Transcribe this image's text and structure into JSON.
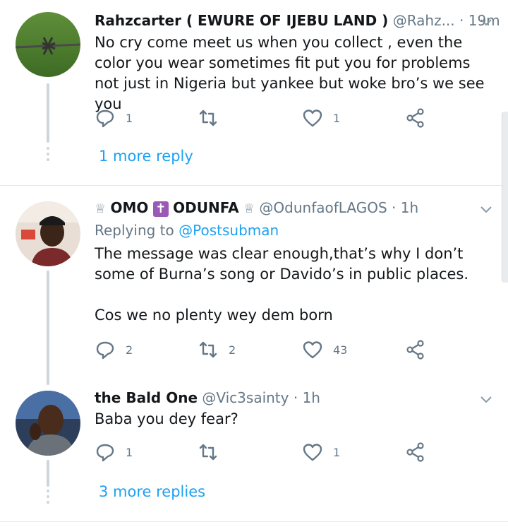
{
  "tweets": [
    {
      "name": "Rahzcarter ( EWURE OF IJEBU LAND )",
      "handle": "@Rahz...",
      "dot": "·",
      "time": "19m",
      "text": "No cry come meet us when you collect , even the color you wear sometimes fit put you for problems not just in Nigeria but yankee but woke bro’s we see you",
      "replies": "1",
      "retweets": "",
      "likes": "1",
      "more": "1 more reply"
    },
    {
      "name_prefix": "♕",
      "name_a": "OMO",
      "name_mid": "✝",
      "name_b": "ODUNFA",
      "name_suffix": "♕",
      "handle": "@OdunfaofLAGOS",
      "dot": "·",
      "time": "1h",
      "replying_label": "Replying to",
      "replying_to": "@Postsubman",
      "text": "The message was clear enough,that’s why I don’t some of Burna’s song or Davido’s in public places.\n\nCos we no plenty wey dem born",
      "replies": "2",
      "retweets": "2",
      "likes": "43"
    },
    {
      "name": "the Bald One",
      "handle": "@Vic3sainty",
      "dot": "·",
      "time": "1h",
      "text": "Baba you dey fear?",
      "replies": "1",
      "retweets": "",
      "likes": "1",
      "more": "3 more replies"
    }
  ],
  "icons": {
    "reply": "reply-icon",
    "retweet": "retweet-icon",
    "like": "heart-icon",
    "share": "share-icon",
    "menu": "chevron-down-icon"
  },
  "colors": {
    "link": "#1da1f2",
    "muted": "#657786",
    "icon": "#657786",
    "thread": "#ccd6dd"
  }
}
